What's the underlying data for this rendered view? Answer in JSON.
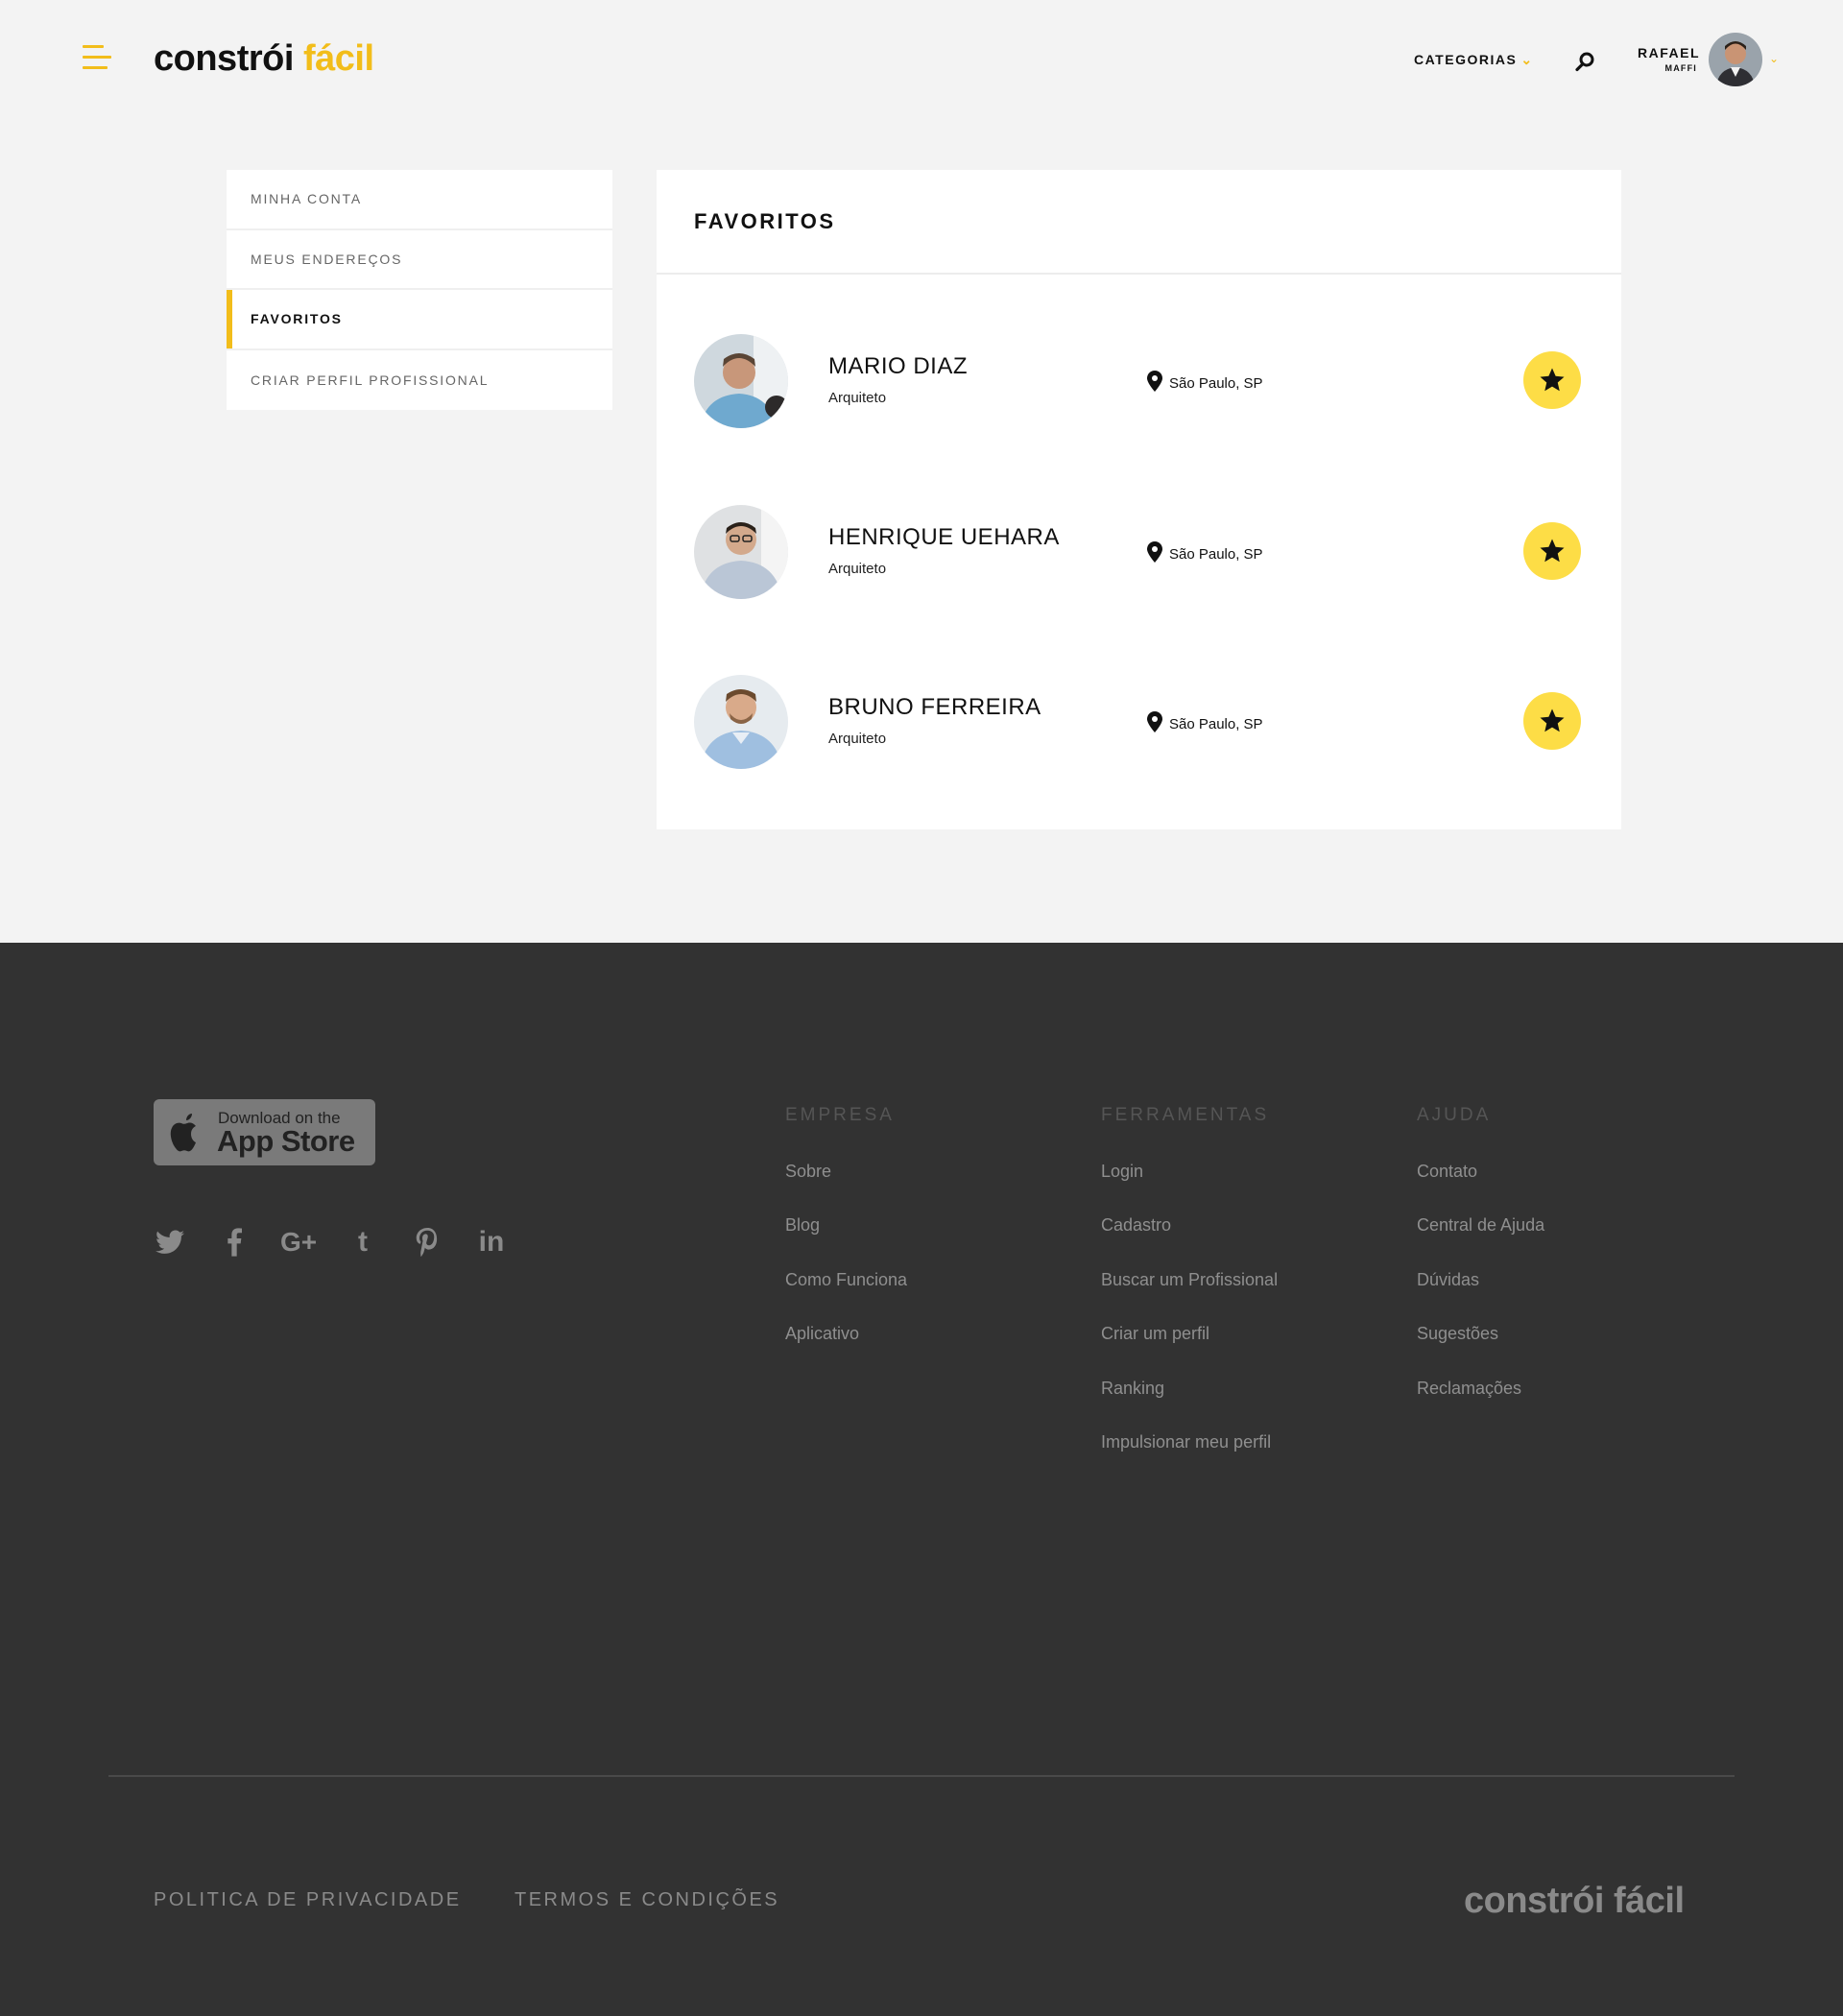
{
  "header": {
    "logo_main": "constrói",
    "logo_accent": "fácil",
    "categories_label": "CATEGORIAS",
    "user_first": "RAFAEL",
    "user_last": "MAFFI"
  },
  "sidebar": {
    "items": [
      {
        "label": "MINHA CONTA"
      },
      {
        "label": "MEUS ENDEREÇOS"
      },
      {
        "label": "FAVORITOS"
      },
      {
        "label": "CRIAR PERFIL PROFISSIONAL"
      }
    ],
    "active_index": 2
  },
  "main": {
    "title": "FAVORITOS",
    "favorites": [
      {
        "name": "MARIO DIAZ",
        "role": "Arquiteto",
        "location": "São Paulo, SP"
      },
      {
        "name": "HENRIQUE UEHARA",
        "role": "Arquiteto",
        "location": "São Paulo, SP"
      },
      {
        "name": "BRUNO FERREIRA",
        "role": "Arquiteto",
        "location": "São Paulo, SP"
      }
    ]
  },
  "footer": {
    "appstore_small": "Download on the",
    "appstore_big": "App Store",
    "socials": [
      "twitter-icon",
      "facebook-icon",
      "google-plus-icon",
      "tumblr-icon",
      "pinterest-icon",
      "linkedin-icon"
    ],
    "columns": [
      {
        "title": "EMPRESA",
        "links": [
          "Sobre",
          "Blog",
          "Como Funciona",
          "Aplicativo"
        ]
      },
      {
        "title": "FERRAMENTAS",
        "links": [
          "Login",
          "Cadastro",
          "Buscar um Profissional",
          "Criar um perfil",
          "Ranking",
          "Impulsionar meu perfil"
        ]
      },
      {
        "title": "AJUDA",
        "links": [
          "Contato",
          "Central de Ajuda",
          "Dúvidas",
          "Sugestões",
          "Reclamações"
        ]
      }
    ],
    "privacy": "POLITICA DE PRIVACIDADE",
    "terms": "TERMOS E CONDIÇÕES",
    "logo": "constrói fácil"
  },
  "colors": {
    "accent": "#f2bd1a",
    "star_bg": "#fddd46",
    "footer_bg": "#323232",
    "page_bg": "#f3f3f3"
  }
}
